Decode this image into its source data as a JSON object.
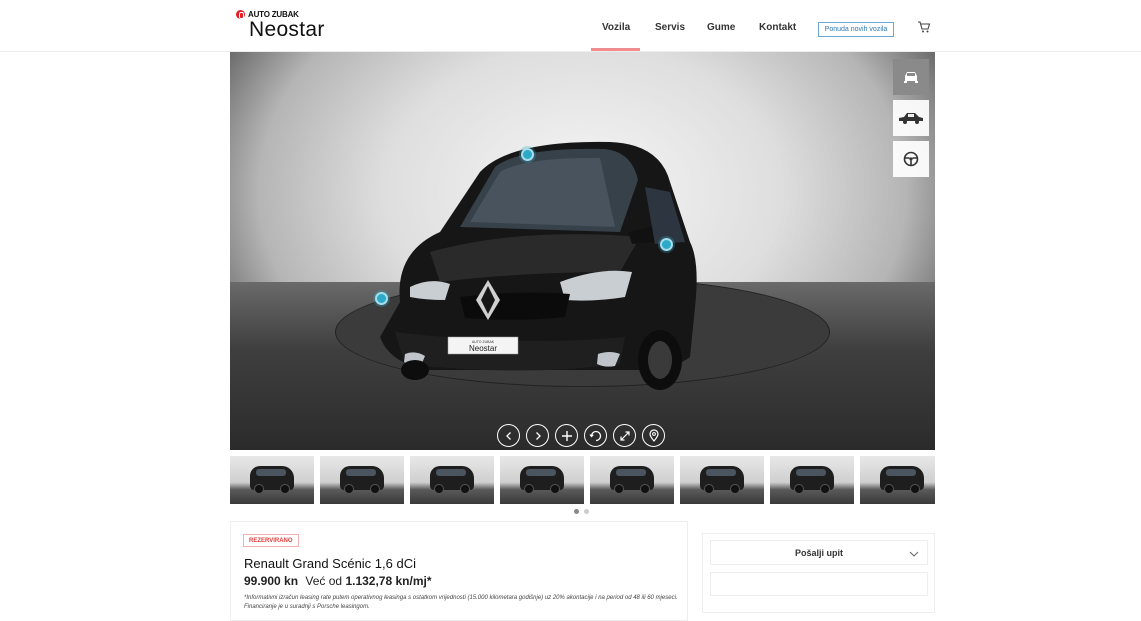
{
  "brand": {
    "top": "AUTO ZUBAK",
    "name": "Neostar"
  },
  "nav": {
    "items": [
      "Vozila",
      "Servis",
      "Gume",
      "Kontakt"
    ],
    "active": "Vozila",
    "offer_button": "Ponuda novih vozila",
    "cart_icon": "cart-icon"
  },
  "viewer": {
    "plate_top": "AUTO ZUBAK",
    "plate_text": "Neostar",
    "view_buttons": [
      "car-front-icon",
      "car-side-icon",
      "steering-wheel-icon"
    ],
    "controls": [
      "chevron-left-icon",
      "chevron-right-icon",
      "plus-icon",
      "rotate-icon",
      "expand-icon",
      "location-pin-icon"
    ]
  },
  "gallery": {
    "thumbnail_count": 8,
    "pages": 2,
    "active_page": 1
  },
  "listing": {
    "status": "REZERVIRANO",
    "title": "Renault Grand Scénic 1,6 dCi",
    "price": "99.900 kn",
    "from_label": "Već od",
    "monthly": "1.132,78 kn/mj*",
    "note": "*Informativni izračun leasing rate putem operativnog leasinga s ostatkom vrijednosti (15.000 kilometara godišnje) uz 20% akontacije i na period od 48 ili 60 mjeseci. Financiranje je u suradnji s Porsche leasingom."
  },
  "inquiry": {
    "label": "Pošalji upit"
  },
  "colors": {
    "accent": "#e31e24",
    "link": "#2d7ab8",
    "hotspot": "#2aa9c9"
  }
}
